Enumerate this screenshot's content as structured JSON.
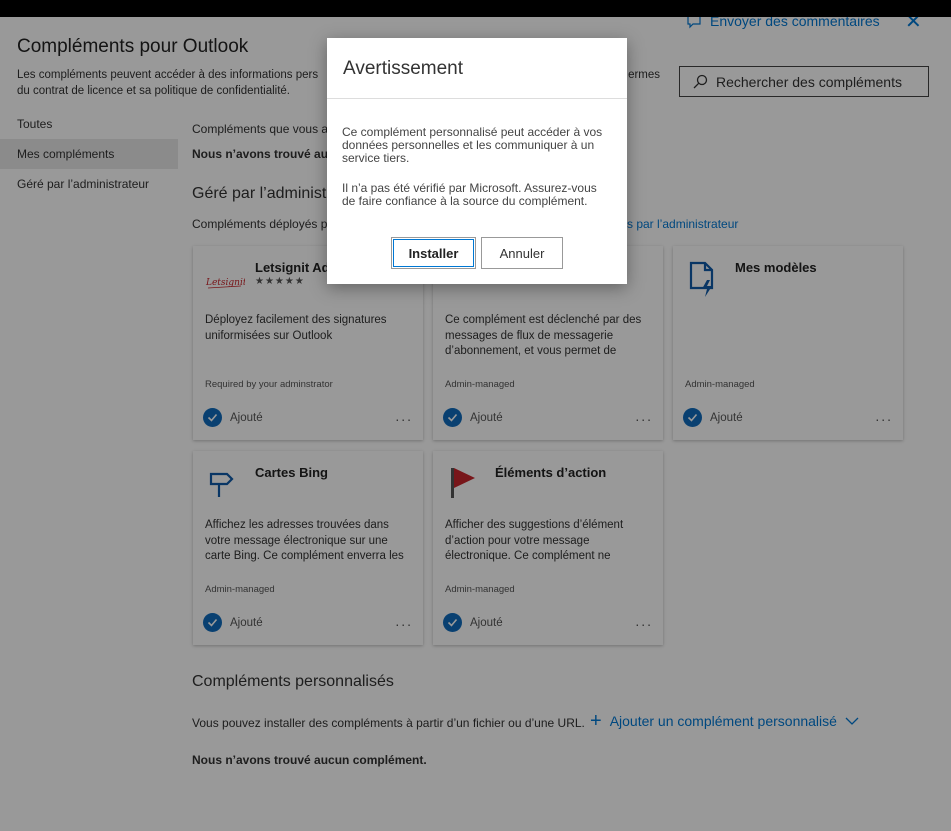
{
  "header": {
    "feedback_label": "Envoyer des commentaires",
    "title": "Compléments pour Outlook",
    "description_line1": "Les compléments peuvent accéder à des informations pers",
    "description_line1_end": "ermes",
    "description_line2": "du contrat de licence et sa politique de confidentialité.",
    "search_placeholder": "Rechercher des compléments"
  },
  "sidebar": {
    "items": [
      {
        "label": "Toutes"
      },
      {
        "label": "Mes compléments"
      },
      {
        "label": "Géré par l’administrateur"
      }
    ]
  },
  "main": {
    "my_addins_intro": "Compléments que vous a",
    "none_found_partial": "Nous n’avons trouvé auc",
    "admin_heading": "Géré par l’administ",
    "admin_intro": "Compléments déployés p",
    "admin_link_tail": "s par l’administrateur",
    "cards": [
      {
        "name": "Letsignit Ade",
        "stars": "★★★★★",
        "description": "Déployez facilement des signatures uniformisées sur Outlook",
        "managed": "Required by your adminstrator",
        "status": "Ajouté",
        "more": "...",
        "logo_text": "Letsignit"
      },
      {
        "name": "",
        "description": "Ce complément est déclenché par des messages de flux de messagerie d’abonnement, et vous permet de",
        "managed": "Admin-managed",
        "status": "Ajouté",
        "more": "..."
      },
      {
        "name": "Mes modèles",
        "description": "",
        "managed": "Admin-managed",
        "status": "Ajouté",
        "more": "..."
      },
      {
        "name": "Cartes Bing",
        "description": "Affichez les adresses trouvées dans votre message électronique sur une carte Bing. Ce complément enverra les",
        "managed": "Admin-managed",
        "status": "Ajouté",
        "more": "..."
      },
      {
        "name": "Éléments d’action",
        "description": "Afficher des suggestions d’élément d’action pour votre message électronique. Ce complément ne",
        "managed": "Admin-managed",
        "status": "Ajouté",
        "more": "..."
      }
    ],
    "custom_heading": "Compléments personnalisés",
    "custom_intro": "Vous pouvez installer des compléments à partir d’un fichier ou d’une URL.",
    "add_custom_label": "Ajouter un complément personnalisé",
    "custom_none": "Nous n’avons trouvé aucun complément."
  },
  "dialog": {
    "title": "Avertissement",
    "paragraph1": "Ce complément personnalisé peut accéder à vos données personnelles et les communiquer à un service tiers.",
    "paragraph2": "Il n’a pas été vérifié par Microsoft. Assurez-vous de faire confiance à la source du complément.",
    "install_label": "Installer",
    "cancel_label": "Annuler"
  },
  "colors": {
    "accent": "#0078d4",
    "check": "#0f6cbd",
    "overlay": "rgba(0,0,0,0.4)"
  }
}
